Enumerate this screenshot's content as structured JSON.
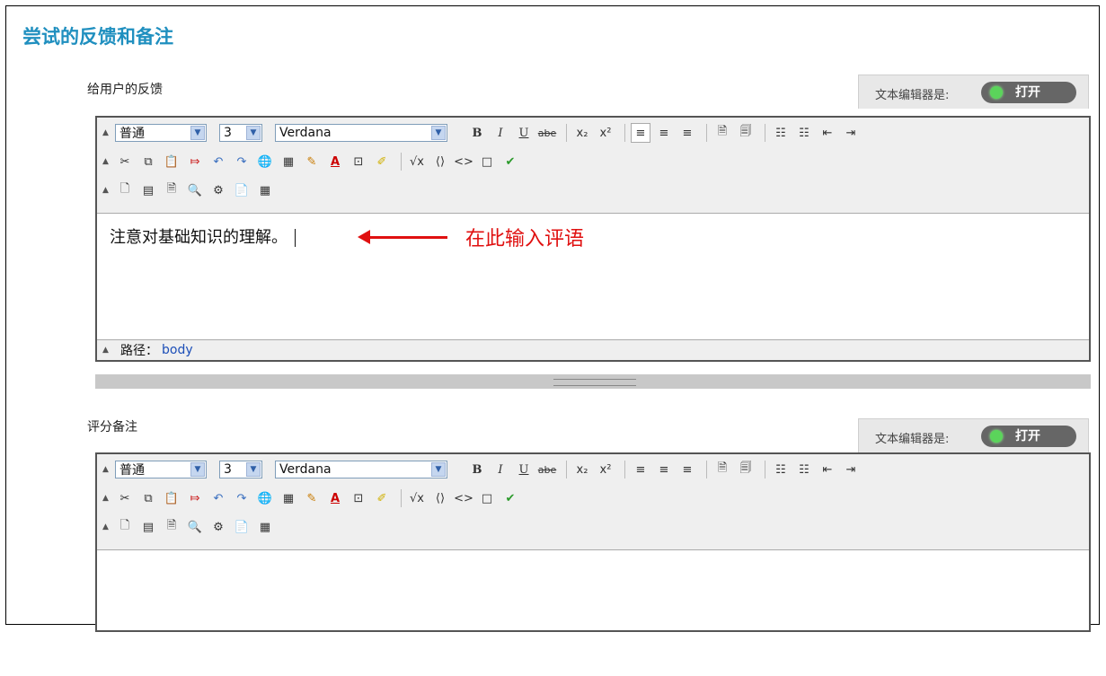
{
  "title": "尝试的反馈和备注",
  "sections": [
    {
      "label": "给用户的反馈",
      "toggle_label": "文本编辑器是:",
      "toggle_button": "打开",
      "format": "普通",
      "size": "3",
      "font": "Verdana",
      "content": "注意对基础知识的理解。",
      "annotation": "在此输入评语",
      "path_label": "路径：",
      "path_value": "body"
    },
    {
      "label": "评分备注",
      "toggle_label": "文本编辑器是:",
      "toggle_button": "打开",
      "format": "普通",
      "size": "3",
      "font": "Verdana"
    }
  ],
  "toolbar_row1": [
    "B",
    "I",
    "U",
    "abe",
    "x₂",
    "x²",
    "≡",
    "≡",
    "≡",
    "🗎",
    "🗐",
    "☷",
    "☷",
    "⇤",
    "⇥"
  ],
  "toolbar_row2": [
    "✂",
    "⧉",
    "📋",
    "⤇",
    "↶",
    "↷",
    "🌐",
    "▦",
    "✎",
    "A",
    "⊡",
    "✐",
    "√x",
    "⟨⟩",
    "<>",
    "□",
    "✔"
  ],
  "toolbar_row3": [
    "🗋",
    "▤",
    "🗎",
    "🔍",
    "⚙",
    "📄",
    "▦"
  ]
}
